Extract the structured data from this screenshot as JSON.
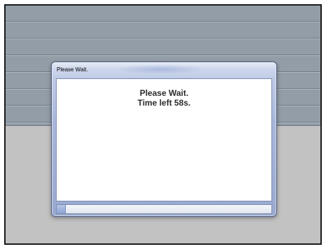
{
  "dialog": {
    "title": "Please Wait.",
    "message_line1": "Please Wait.",
    "message_line2": "Time left 58s.",
    "progress_fraction": 0.04
  },
  "colors": {
    "desktop_stripes": "#939da7",
    "desktop_lower": "#c2c2c2",
    "dialog_frame": "#a9b7da",
    "message_text": "#2a2a2a"
  }
}
